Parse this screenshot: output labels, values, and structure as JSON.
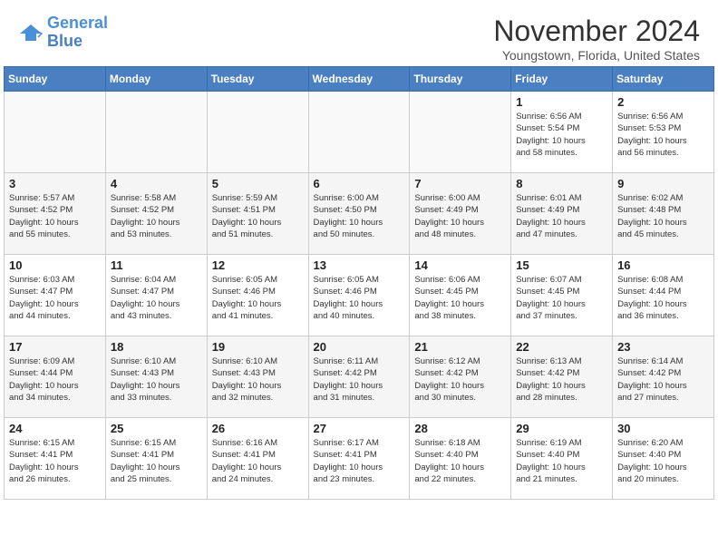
{
  "header": {
    "logo_line1": "General",
    "logo_line2": "Blue",
    "month": "November 2024",
    "location": "Youngstown, Florida, United States"
  },
  "days_of_week": [
    "Sunday",
    "Monday",
    "Tuesday",
    "Wednesday",
    "Thursday",
    "Friday",
    "Saturday"
  ],
  "weeks": [
    [
      {
        "day": "",
        "info": ""
      },
      {
        "day": "",
        "info": ""
      },
      {
        "day": "",
        "info": ""
      },
      {
        "day": "",
        "info": ""
      },
      {
        "day": "",
        "info": ""
      },
      {
        "day": "1",
        "info": "Sunrise: 6:56 AM\nSunset: 5:54 PM\nDaylight: 10 hours\nand 58 minutes."
      },
      {
        "day": "2",
        "info": "Sunrise: 6:56 AM\nSunset: 5:53 PM\nDaylight: 10 hours\nand 56 minutes."
      }
    ],
    [
      {
        "day": "3",
        "info": "Sunrise: 5:57 AM\nSunset: 4:52 PM\nDaylight: 10 hours\nand 55 minutes."
      },
      {
        "day": "4",
        "info": "Sunrise: 5:58 AM\nSunset: 4:52 PM\nDaylight: 10 hours\nand 53 minutes."
      },
      {
        "day": "5",
        "info": "Sunrise: 5:59 AM\nSunset: 4:51 PM\nDaylight: 10 hours\nand 51 minutes."
      },
      {
        "day": "6",
        "info": "Sunrise: 6:00 AM\nSunset: 4:50 PM\nDaylight: 10 hours\nand 50 minutes."
      },
      {
        "day": "7",
        "info": "Sunrise: 6:00 AM\nSunset: 4:49 PM\nDaylight: 10 hours\nand 48 minutes."
      },
      {
        "day": "8",
        "info": "Sunrise: 6:01 AM\nSunset: 4:49 PM\nDaylight: 10 hours\nand 47 minutes."
      },
      {
        "day": "9",
        "info": "Sunrise: 6:02 AM\nSunset: 4:48 PM\nDaylight: 10 hours\nand 45 minutes."
      }
    ],
    [
      {
        "day": "10",
        "info": "Sunrise: 6:03 AM\nSunset: 4:47 PM\nDaylight: 10 hours\nand 44 minutes."
      },
      {
        "day": "11",
        "info": "Sunrise: 6:04 AM\nSunset: 4:47 PM\nDaylight: 10 hours\nand 43 minutes."
      },
      {
        "day": "12",
        "info": "Sunrise: 6:05 AM\nSunset: 4:46 PM\nDaylight: 10 hours\nand 41 minutes."
      },
      {
        "day": "13",
        "info": "Sunrise: 6:05 AM\nSunset: 4:46 PM\nDaylight: 10 hours\nand 40 minutes."
      },
      {
        "day": "14",
        "info": "Sunrise: 6:06 AM\nSunset: 4:45 PM\nDaylight: 10 hours\nand 38 minutes."
      },
      {
        "day": "15",
        "info": "Sunrise: 6:07 AM\nSunset: 4:45 PM\nDaylight: 10 hours\nand 37 minutes."
      },
      {
        "day": "16",
        "info": "Sunrise: 6:08 AM\nSunset: 4:44 PM\nDaylight: 10 hours\nand 36 minutes."
      }
    ],
    [
      {
        "day": "17",
        "info": "Sunrise: 6:09 AM\nSunset: 4:44 PM\nDaylight: 10 hours\nand 34 minutes."
      },
      {
        "day": "18",
        "info": "Sunrise: 6:10 AM\nSunset: 4:43 PM\nDaylight: 10 hours\nand 33 minutes."
      },
      {
        "day": "19",
        "info": "Sunrise: 6:10 AM\nSunset: 4:43 PM\nDaylight: 10 hours\nand 32 minutes."
      },
      {
        "day": "20",
        "info": "Sunrise: 6:11 AM\nSunset: 4:42 PM\nDaylight: 10 hours\nand 31 minutes."
      },
      {
        "day": "21",
        "info": "Sunrise: 6:12 AM\nSunset: 4:42 PM\nDaylight: 10 hours\nand 30 minutes."
      },
      {
        "day": "22",
        "info": "Sunrise: 6:13 AM\nSunset: 4:42 PM\nDaylight: 10 hours\nand 28 minutes."
      },
      {
        "day": "23",
        "info": "Sunrise: 6:14 AM\nSunset: 4:42 PM\nDaylight: 10 hours\nand 27 minutes."
      }
    ],
    [
      {
        "day": "24",
        "info": "Sunrise: 6:15 AM\nSunset: 4:41 PM\nDaylight: 10 hours\nand 26 minutes."
      },
      {
        "day": "25",
        "info": "Sunrise: 6:15 AM\nSunset: 4:41 PM\nDaylight: 10 hours\nand 25 minutes."
      },
      {
        "day": "26",
        "info": "Sunrise: 6:16 AM\nSunset: 4:41 PM\nDaylight: 10 hours\nand 24 minutes."
      },
      {
        "day": "27",
        "info": "Sunrise: 6:17 AM\nSunset: 4:41 PM\nDaylight: 10 hours\nand 23 minutes."
      },
      {
        "day": "28",
        "info": "Sunrise: 6:18 AM\nSunset: 4:40 PM\nDaylight: 10 hours\nand 22 minutes."
      },
      {
        "day": "29",
        "info": "Sunrise: 6:19 AM\nSunset: 4:40 PM\nDaylight: 10 hours\nand 21 minutes."
      },
      {
        "day": "30",
        "info": "Sunrise: 6:20 AM\nSunset: 4:40 PM\nDaylight: 10 hours\nand 20 minutes."
      }
    ]
  ]
}
